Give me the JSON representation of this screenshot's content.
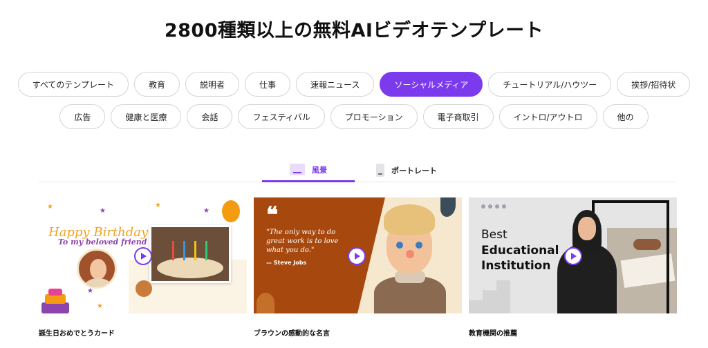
{
  "header": {
    "title": "2800種類以上の無料AIビデオテンプレート"
  },
  "categories": {
    "row1": [
      {
        "label": "すべてのテンプレート",
        "active": false
      },
      {
        "label": "教育",
        "active": false
      },
      {
        "label": "説明者",
        "active": false
      },
      {
        "label": "仕事",
        "active": false
      },
      {
        "label": "速報ニュース",
        "active": false
      },
      {
        "label": "ソーシャルメディア",
        "active": true
      },
      {
        "label": "チュートリアル/ハウツー",
        "active": false
      },
      {
        "label": "挨拶/招待状",
        "active": false
      }
    ],
    "row2": [
      {
        "label": "広告",
        "active": false
      },
      {
        "label": "健康と医療",
        "active": false
      },
      {
        "label": "会話",
        "active": false
      },
      {
        "label": "フェスティバル",
        "active": false
      },
      {
        "label": "プロモーション",
        "active": false
      },
      {
        "label": "電子商取引",
        "active": false
      },
      {
        "label": "イントロ/アウトロ",
        "active": false
      },
      {
        "label": "他の",
        "active": false
      }
    ]
  },
  "orientation_tabs": {
    "landscape": {
      "label": "風景",
      "icon": "landscape-icon",
      "active": true
    },
    "portrait": {
      "label": "ポートレート",
      "icon": "portrait-icon",
      "active": false
    }
  },
  "colors": {
    "accent": "#7c3aed"
  },
  "templates": [
    {
      "title": "誕生日おめでとうカード",
      "thumb_text": {
        "line1": "Happy Birthday",
        "line2": "To my beloved friend"
      }
    },
    {
      "title": "ブラウンの感動的な名言",
      "thumb_text": {
        "mark": "❝",
        "quote": "\"The only way to do great work is to love what you do.\"",
        "author": "— Steve Jobs"
      }
    },
    {
      "title": "教育機関の推薦",
      "thumb_text": {
        "line1": "Best",
        "line2": "Educational",
        "line3": "Institution"
      }
    }
  ]
}
